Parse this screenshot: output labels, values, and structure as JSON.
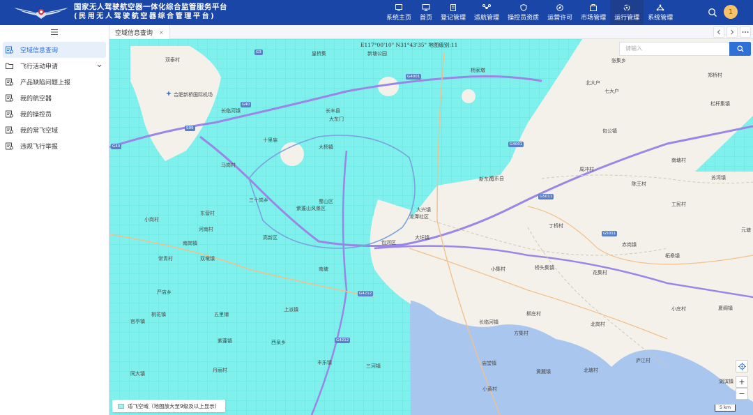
{
  "header": {
    "title_line1": "国家无人驾驶航空器一体化综合监管服务平台",
    "title_line2": "(民用无人驾驶航空器综合管理平台)",
    "nav": [
      {
        "label": "系统主页",
        "icon": "home-screen-icon",
        "active": false
      },
      {
        "label": "首页",
        "icon": "monitor-icon",
        "active": false
      },
      {
        "label": "登记管理",
        "icon": "document-edit-icon",
        "active": false
      },
      {
        "label": "适航管理",
        "icon": "drone-icon",
        "active": false
      },
      {
        "label": "操控员资质",
        "icon": "shield-icon",
        "active": false
      },
      {
        "label": "运营许可",
        "icon": "compass-icon",
        "active": false
      },
      {
        "label": "市场管理",
        "icon": "briefcase-icon",
        "active": false
      },
      {
        "label": "运行管理",
        "icon": "refresh-gear-icon",
        "active": true
      },
      {
        "label": "系统管理",
        "icon": "network-icon",
        "active": false
      }
    ],
    "avatar_text": "1"
  },
  "sidebar": {
    "items": [
      {
        "label": "空域信息查询",
        "icon": "airspace-icon",
        "active": true
      },
      {
        "label": "飞行活动申请",
        "icon": "folder-icon",
        "active": false,
        "expandable": true
      },
      {
        "label": "产品缺陷问题上报",
        "icon": "report-icon",
        "active": false
      },
      {
        "label": "我的航空器",
        "icon": "aircraft-icon",
        "active": false
      },
      {
        "label": "我的操控员",
        "icon": "operator-icon",
        "active": false
      },
      {
        "label": "我的常飞空域",
        "icon": "route-icon",
        "active": false
      },
      {
        "label": "违规飞行举报",
        "icon": "warning-icon",
        "active": false
      }
    ]
  },
  "tabs": [
    {
      "label": "空域信息查询",
      "close": "×"
    }
  ],
  "map": {
    "coord_text": "E117°00'10\"   N31°43'35\"   地图级别:11",
    "search_placeholder": "请输入",
    "legend_text": "适飞空域（地图放大至9级及以上显示）",
    "scale_text": "5 km",
    "zoom_in": "+",
    "zoom_out": "−",
    "colors": {
      "airspace": "#7ff0ec",
      "water": "#a9c6ee",
      "highway": "#9b86e6",
      "nav_bg": "#1a46a8"
    },
    "places": [
      "双泰村",
      "皇桥集",
      "新塘公园",
      "杨家墩",
      "张集乡",
      "北大户",
      "合肥新桥国际机场",
      "长临河镇",
      "七大户",
      "栏杆集镇",
      "包公镇",
      "郑桥村",
      "马岗村",
      "周冲村",
      "南塘村",
      "陈王村",
      "苏湾镇",
      "工民村",
      "元塘",
      "赤岗镇",
      "柘皋镇",
      "丁桥村",
      "小集村",
      "桥头集镇",
      "花集村",
      "小庄村",
      "夏阁镇",
      "长临河镇",
      "柳庄村",
      "北岗村",
      "庙堂镇",
      "方集村",
      "黄麓镇",
      "北塘村",
      "湖滨镇",
      "小黄村",
      "庐江村",
      "大杨镇",
      "十里庙",
      "长丰县",
      "三十岗乡",
      "东营村",
      "小岗村",
      "河南村",
      "紫蓬山风景区",
      "高新区",
      "南岗镇",
      "蜀山区",
      "包河区",
      "肥东县",
      "龙潭社区",
      "上派镇",
      "严店乡",
      "官亭镇",
      "西泉乡",
      "双墩镇",
      "桃花镇",
      "丰乐镇",
      "丹丽村",
      "大圩镇",
      "紫蓬镇",
      "三河镇",
      "大东门",
      "常青村",
      "南塘",
      "新东门",
      "同大镇",
      "大兴镇",
      "五里铺"
    ]
  }
}
